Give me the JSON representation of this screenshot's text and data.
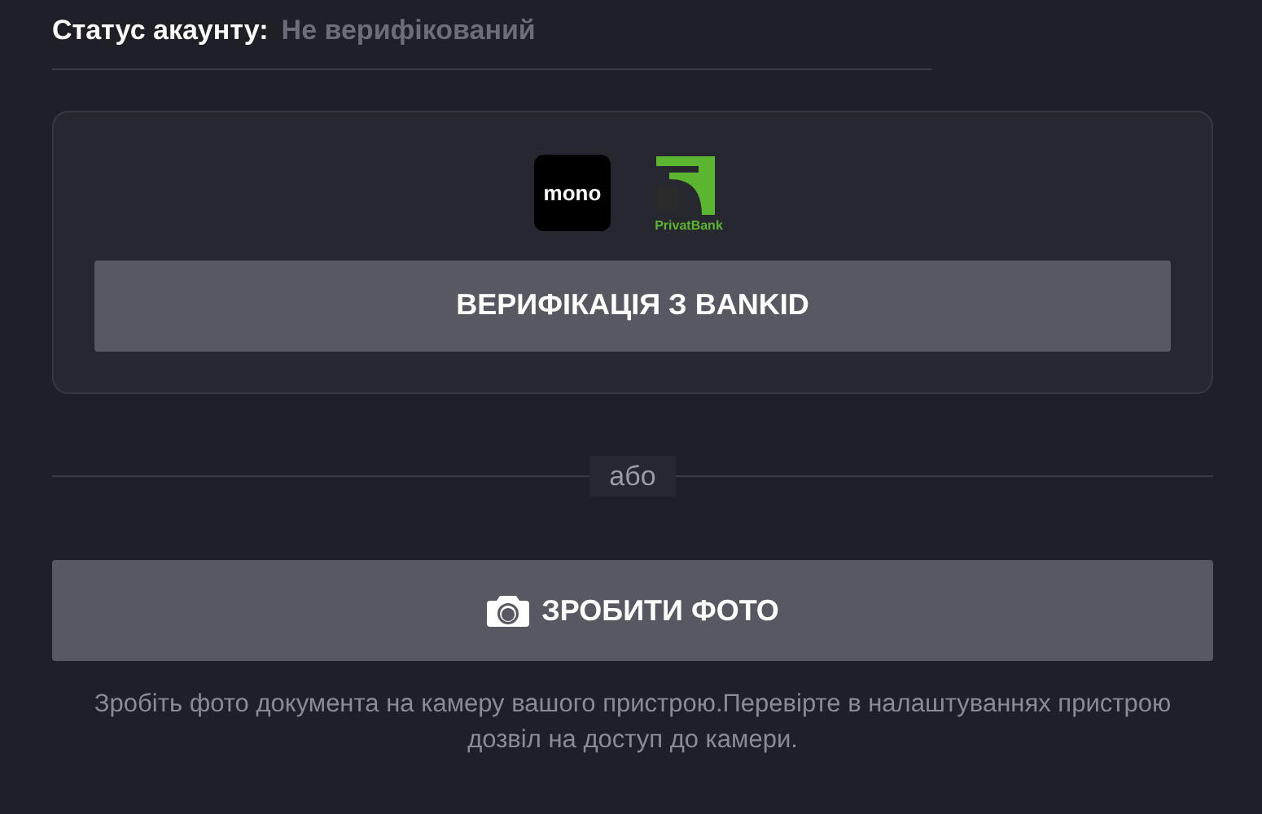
{
  "account_status": {
    "label": "Статус акаунту:",
    "value": "Не верифікований"
  },
  "bankid_card": {
    "banks": [
      {
        "kind": "mono",
        "logo_text": "mono"
      },
      {
        "kind": "privat",
        "logo_text": "PrivatBank"
      }
    ],
    "button": "ВЕРИФІКАЦІЯ З BANKID"
  },
  "separator": "або",
  "photo_button": "ЗРОБИТИ ФОТО",
  "hint": "Зробіть фото документа на камеру вашого пристрою.Перевірте в налаштуваннях пристрою дозвіл на доступ до камери."
}
